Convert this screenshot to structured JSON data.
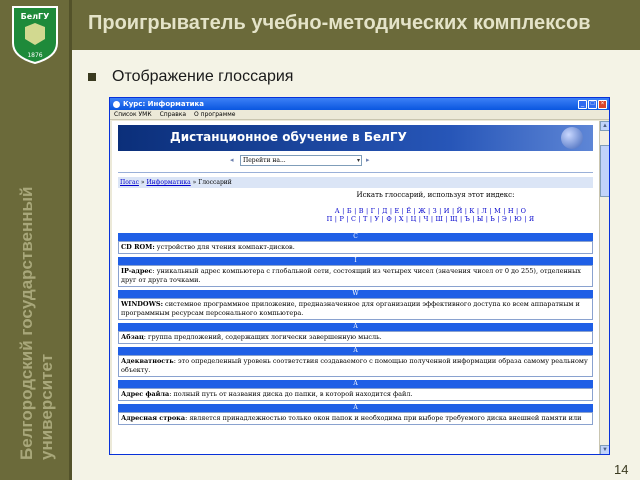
{
  "slide": {
    "logo_text": "БелГУ",
    "logo_year": "1876",
    "title": "Проигрыватель учебно-методических комплексов",
    "bullet_text": "Отображение глоссария",
    "side_text": "Белгородский государственный университет",
    "page_number": "14"
  },
  "browser": {
    "window_title": "Курс: Информатика",
    "menu": [
      "Список УМК",
      "Справка",
      "О программе"
    ],
    "banner_title": "Дистанционное обучение в БелГУ",
    "nav_select_value": "Перейти на...",
    "breadcrumb": {
      "home": "Погас",
      "course": "Информатика",
      "sep": "»",
      "current": "Глоссарий"
    },
    "search_label": "Искать глоссарий, используя этот индекс:",
    "alphabet_row1": "А | Б | В | Г | Д | Е | Ё | Ж | З | И | Й | К | Л | М | Н | О",
    "alphabet_row2": "П | Р | С | Т | У | Ф | Х | Ц | Ч | Ш | Щ | Ъ | Ы | Ь | Э | Ю | Я",
    "entries": [
      {
        "letter": "C",
        "term": "CD ROM:",
        "text": " устройство для чтения компакт-дисков."
      },
      {
        "letter": "I",
        "term": "IP-адрес",
        "text": ": уникальный адрес компьютера с глобальной сети, состоящий из четырех чисел (значения чисел от 0 до 255), отделенных друг от друга точками."
      },
      {
        "letter": "W",
        "term": "WINDOWS:",
        "text": " системное программное приложение, предназначенное для организации эффективного доступа ко всем аппаратным и программным ресурсам персонального компьютера."
      },
      {
        "letter": "A",
        "term": "Абзац",
        "text": ": группа предложений, содержащих логически завершенную мысль."
      },
      {
        "letter": "A",
        "term": "Адекватность",
        "text": ": это определенный уровень соответствия создаваемого с помощью полученной информации образа самому реальному объекту."
      },
      {
        "letter": "A",
        "term": "Адрес файла",
        "text": ": полный путь от названия диска до папки, в которой находится файл."
      },
      {
        "letter": "A",
        "term": "Адресная строка",
        "text": ": является принадлежностью только окон папок и необходима при выборе требуемого диска внешней памяти или"
      }
    ]
  },
  "colors": {
    "slide_band": "#6b6a3a",
    "glossary_header": "#1f5fe6",
    "banner": "#0b2f7a"
  }
}
